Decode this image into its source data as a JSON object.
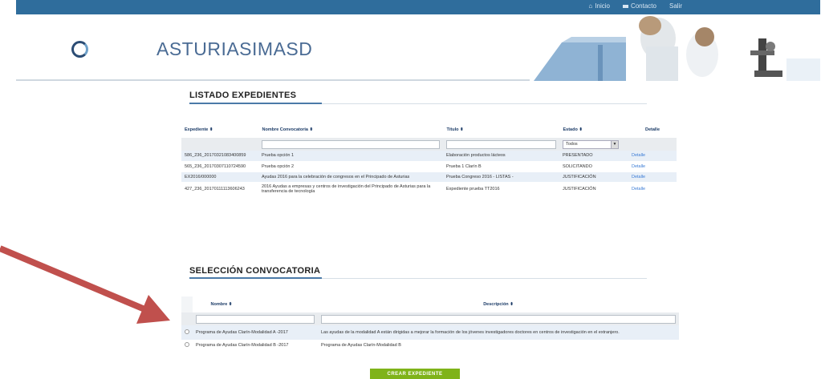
{
  "topnav": {
    "home": "Inicio",
    "contact": "Contacto",
    "logout": "Salir"
  },
  "brand": "ASTURIASIMASD",
  "expedientes": {
    "title": "LISTADO EXPEDIENTES",
    "columns": [
      "Expediente",
      "Nombre Convocatoria",
      "Título",
      "Estado",
      "Detalle"
    ],
    "estado_filter": "Todos",
    "rows": [
      {
        "exp": "586_236_20170321083400859",
        "conv": "Prueba opción 1",
        "titulo": "Elaboración productos lácteos",
        "estado": "PRESENTADO",
        "detalle": "Detalle"
      },
      {
        "exp": "565_236_20170307110724590",
        "conv": "Prueba opción 2",
        "titulo": "Prueba 1 Clarín B",
        "estado": "SOLICITANDO",
        "detalle": "Detalle"
      },
      {
        "exp": "EX2016/000000",
        "conv": "Ayudas 2016 para la celebración de congresos en el Principado de Asturias",
        "titulo": "Prueba Congreso 2016 - LISTAS -",
        "estado": "JUSTIFICACIÓN",
        "detalle": "Detalle"
      },
      {
        "exp": "427_236_20170111113606243",
        "conv": "2016 Ayudas a empresas y centros de investigación del Principado de Asturias para la transferencia de tecnología",
        "titulo": "Expediente prueba TT2016",
        "estado": "JUSTIFICACIÓN",
        "detalle": "Detalle"
      }
    ]
  },
  "convocatoria": {
    "title": "SELECCIÓN CONVOCATORIA",
    "columns": [
      "Nombre",
      "Descripción"
    ],
    "rows": [
      {
        "nombre": "Programa de Ayudas Clarín-Modalidad A -2017",
        "descripcion": "Las ayudas de la modalidad A están dirigidas a mejorar la formación de los jóvenes investigadores doctores en centros de investigación en el extranjero."
      },
      {
        "nombre": "Programa de Ayudas Clarín-Modalidad B -2017",
        "descripcion": "Programa de Ayudas Clarín-Modalidad B"
      }
    ]
  },
  "create_button": "CREAR EXPEDIENTE",
  "colors": {
    "topbar": "#2f6d9c",
    "brand": "#4a6b94",
    "button": "#7fb319",
    "arrow": "#c0504d"
  }
}
